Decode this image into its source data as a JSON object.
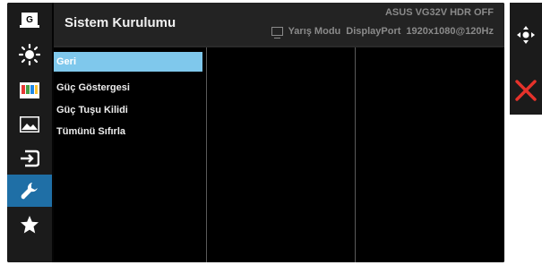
{
  "osd": {
    "title": "Sistem Kurulumu",
    "model": "ASUS VG32V HDR OFF",
    "status": {
      "mode": "Yarış Modu",
      "input": "DisplayPort",
      "resolution": "1920x1080@120Hz"
    }
  },
  "sidebar": {
    "items": [
      {
        "icon": "gameplus-icon",
        "label": "G"
      },
      {
        "icon": "brightness-icon"
      },
      {
        "icon": "color-icon"
      },
      {
        "icon": "image-icon"
      },
      {
        "icon": "input-select-icon"
      },
      {
        "icon": "system-setup-icon",
        "active": true
      },
      {
        "icon": "favorite-star-icon"
      }
    ]
  },
  "menu": {
    "items": [
      "Geri",
      "Güç Göstergesi",
      "Güç Tuşu Kilidi",
      "Tümünü Sıfırla"
    ],
    "selected_index": 0
  },
  "nav": {
    "buttons": [
      {
        "icon": "five-way-joystick-icon"
      },
      {
        "icon": "close-icon"
      }
    ]
  },
  "colors": {
    "active_tab": "#1f6fa6",
    "selected_row": "#7fc8ec",
    "close": "#e6322b"
  }
}
